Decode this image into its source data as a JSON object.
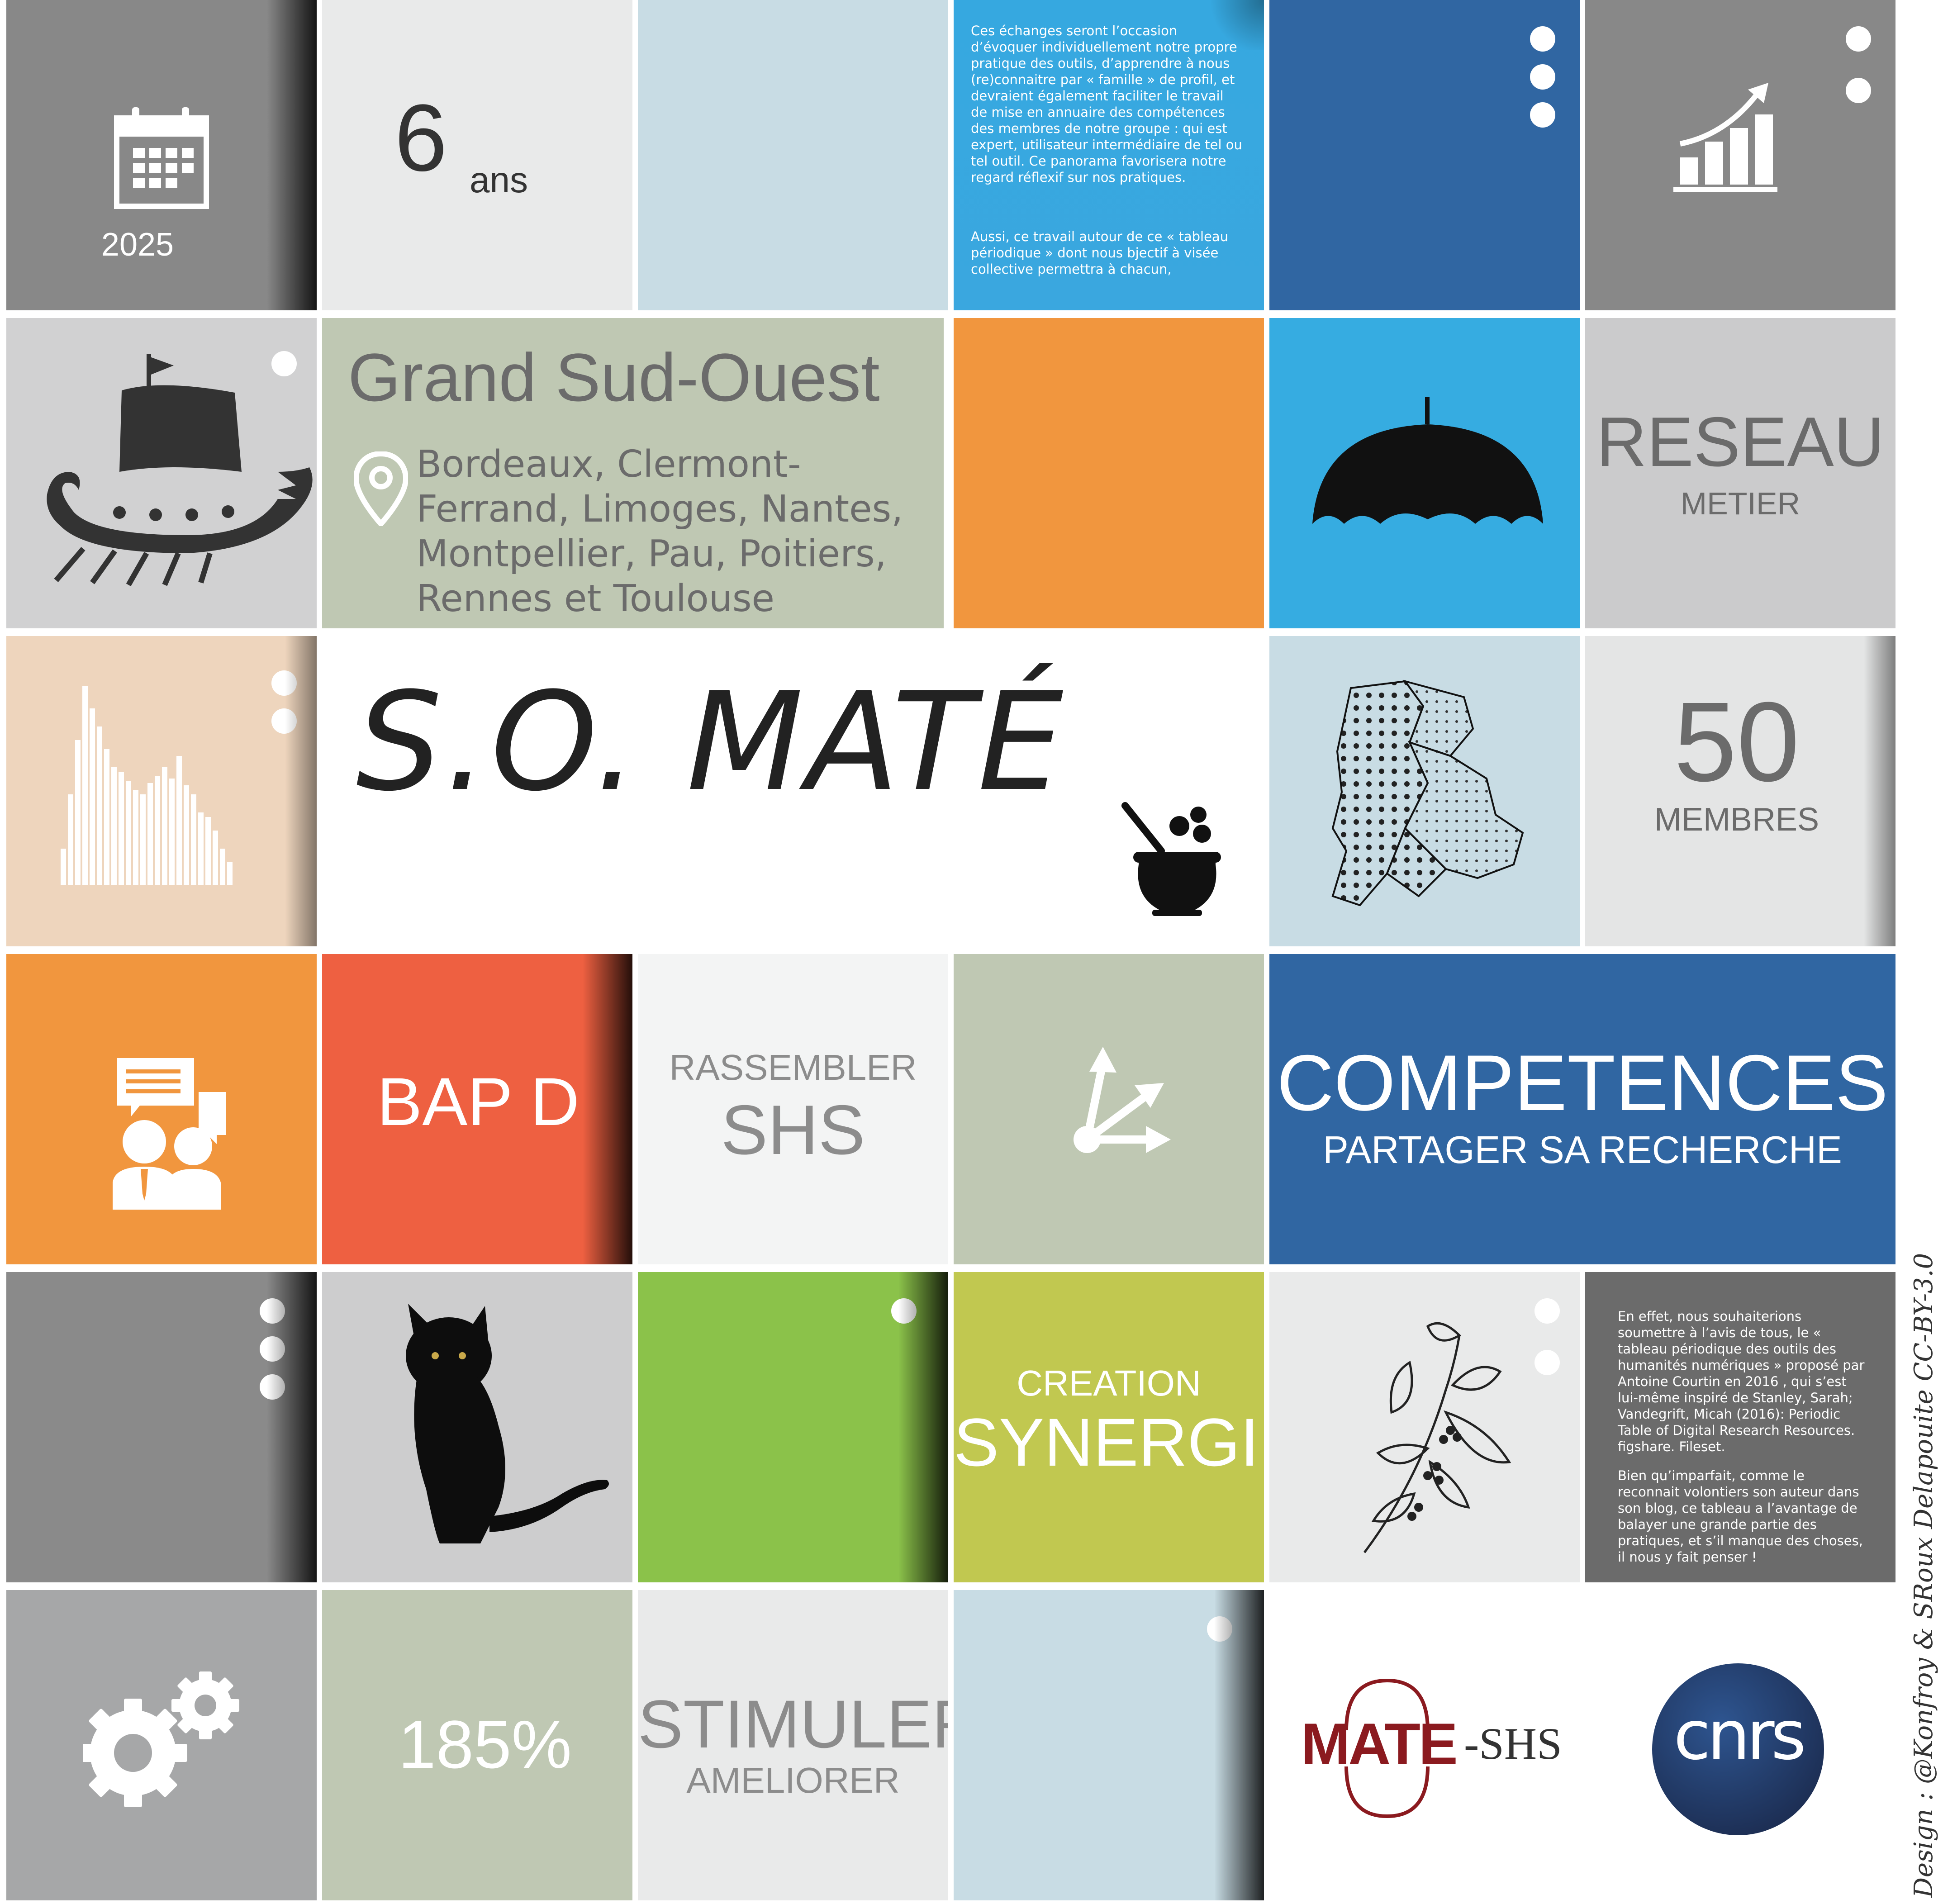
{
  "calendar": {
    "year": "2025"
  },
  "age": {
    "number": "6",
    "unit": "ans"
  },
  "text_top": {
    "paragraph1": "Ces échanges seront l’occasion d’évoquer individuellement notre propre pratique des outils, d’apprendre à nous (re)connaitre par « famille » de profil, et devraient également faciliter le travail de mise en annuaire des compétences des membres de notre groupe : qui est expert, utilisateur intermédiaire de tel ou tel outil. Ce panorama favorisera notre regard réflexif sur nos pratiques.",
    "paragraph2": "Aussi, ce travail autour de ce « tableau périodique » dont nous bjectif à visée collective permettra à chacun,"
  },
  "region": {
    "title": "Grand Sud-Ouest",
    "cities_lines": [
      "Bordeaux, Clermont-",
      "Ferrand, Limoges, Nantes,",
      "Montpellier, Pau, Poitiers,",
      "Rennes et Toulouse"
    ]
  },
  "network": {
    "title": "RESEAU",
    "subtitle": "METIER"
  },
  "logo": {
    "text": "S.O. MATÉ"
  },
  "members": {
    "count": "50",
    "label": "MEMBRES"
  },
  "bap": {
    "label": "BAP D"
  },
  "gather": {
    "line1": "RASSEMBLER",
    "line2": "SHS"
  },
  "competences": {
    "title": "COMPETENCES",
    "subtitle": "PARTAGER SA RECHERCHE"
  },
  "synergy": {
    "line1": "CREATION",
    "line2": "SYNERGIE"
  },
  "text_bottom": {
    "paragraph1": "En effet, nous souhaiterions soumettre à l’avis de tous, le « tableau périodique des outils des humanités numériques » proposé par Antoine Courtin en 2016 , qui s’est lui-même inspiré de Stanley, Sarah; Vandegrift, Micah (2016): Periodic Table of Digital Research Resources. figshare. Fileset.",
    "paragraph2": "Bien qu’imparfait, comme le reconnait volontiers son auteur dans son blog, ce tableau a l’avantage de balayer une grande partie des pratiques, et s’il manque des choses, il nous y fait penser !"
  },
  "percent": {
    "value": "185%"
  },
  "stimulate": {
    "line1": "STIMULER",
    "line2": "AMELIORER"
  },
  "mate_logo": {
    "part1": "MATE",
    "part2": "-SHS"
  },
  "cnrs_logo": {
    "text": "cnrs"
  },
  "credit": {
    "text": "Design : @Konfroy & SRoux Delapouite CC-BY-3.0"
  },
  "colors": {
    "dark_gray": "#888888",
    "light_gray": "#e9eaea",
    "pale_blue": "#c8dce4",
    "sky_blue": "#36a8e0",
    "royal_blue": "#3066a2",
    "sage": "#bfc8b3",
    "orange": "#f1963e",
    "red_orange": "#ee6041",
    "green": "#8bc24a",
    "olive": "#c1c850",
    "beige": "#eed5bd",
    "dark": "#6b6b6b"
  }
}
